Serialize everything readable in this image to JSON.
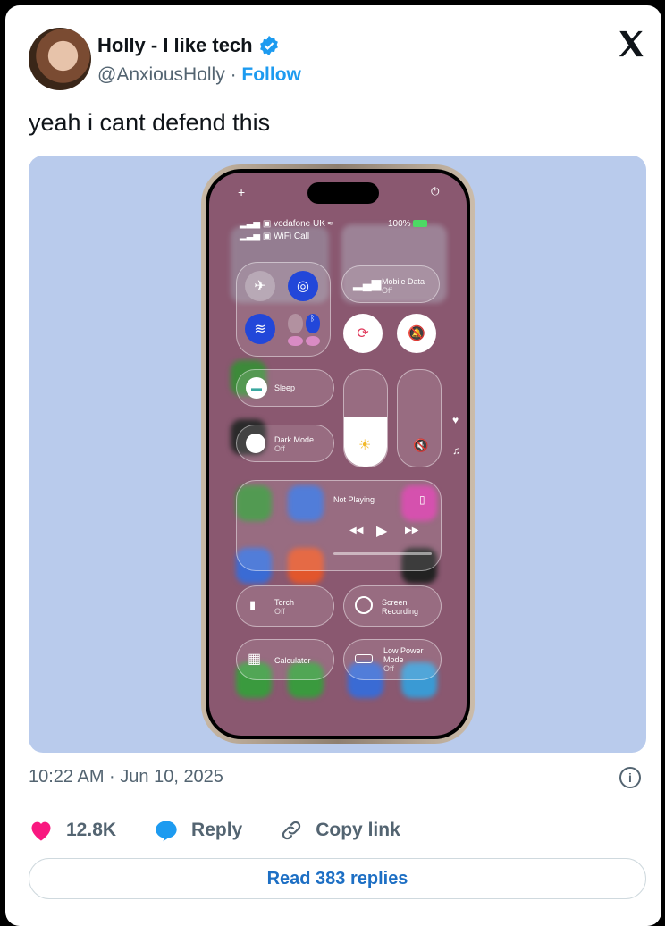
{
  "tweet": {
    "author_name": "Holly - I like tech",
    "handle": "@AnxiousHolly",
    "separator": "·",
    "follow_label": "Follow",
    "text": "yeah i cant defend this",
    "timestamp": "10:22 AM · Jun 10, 2025",
    "likes": "12.8K",
    "reply_label": "Reply",
    "copy_label": "Copy link",
    "read_replies": "Read 383 replies"
  },
  "phone": {
    "carrier": "vodafone UK",
    "wifi_call": "WiFi Call",
    "battery": "100%",
    "mobile_data": {
      "title": "Mobile Data",
      "state": "Off"
    },
    "sleep": "Sleep",
    "dark_mode": {
      "title": "Dark Mode",
      "state": "Off"
    },
    "not_playing": "Not Playing",
    "torch": {
      "title": "Torch",
      "state": "Off"
    },
    "screen_recording": {
      "line1": "Screen",
      "line2": "Recording"
    },
    "calculator": "Calculator",
    "low_power": {
      "line1": "Low Power",
      "line2": "Mode",
      "state": "Off"
    }
  },
  "colors": {
    "accent": "#1d9bf0",
    "like": "#f91880",
    "media_bg": "#b9cbec"
  },
  "icons": [
    "verified-badge-icon",
    "x-logo-icon",
    "info-icon",
    "heart-icon",
    "reply-bubble-icon",
    "link-icon"
  ]
}
